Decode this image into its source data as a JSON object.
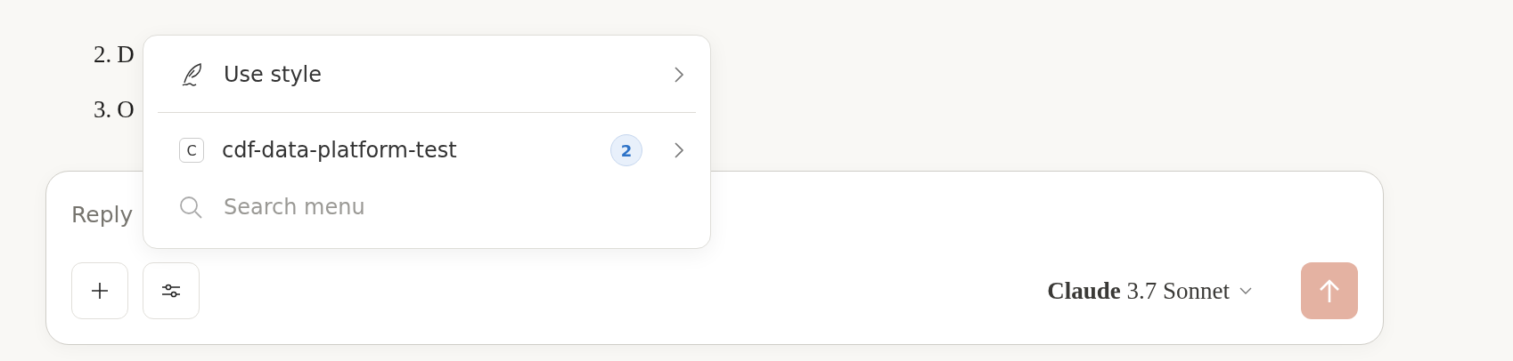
{
  "background_text": {
    "list_items": [
      {
        "number": "2.",
        "text": "D"
      },
      {
        "number": "3.",
        "text": "O"
      }
    ]
  },
  "menu": {
    "items": [
      {
        "kind": "style",
        "label": "Use style"
      },
      {
        "kind": "project",
        "label": "cdf-data-platform-test",
        "icon_letter": "C",
        "count": "2"
      }
    ],
    "search": {
      "placeholder": "Search menu"
    }
  },
  "composer": {
    "placeholder": "Reply",
    "model": "**Claude** 3.7 Sonnet",
    "send_disabled": true
  }
}
